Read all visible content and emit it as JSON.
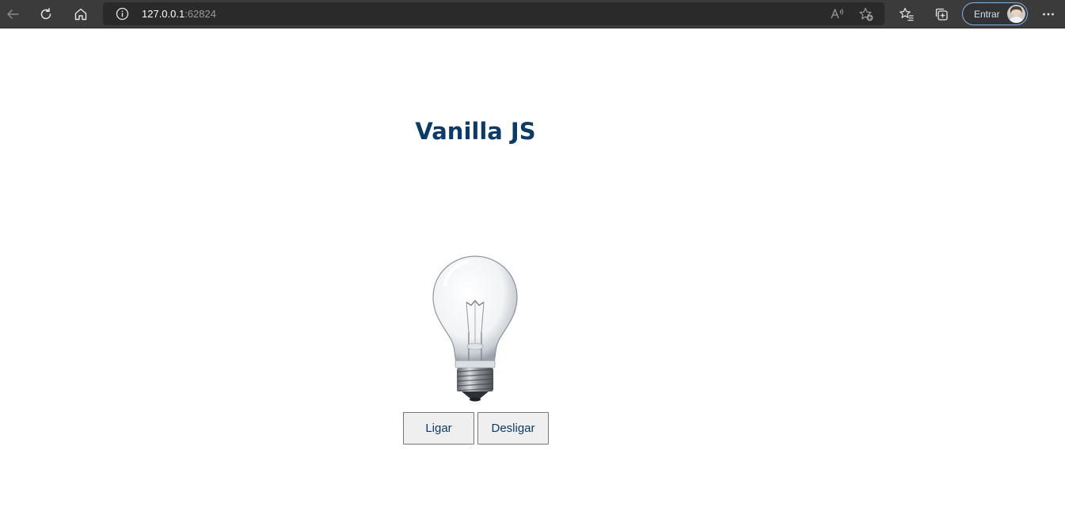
{
  "browser": {
    "url_host": "127.0.0.1",
    "url_port": ":62824",
    "profile_label": "Entrar",
    "icons": {
      "back": "arrow-left-icon",
      "refresh": "refresh-icon",
      "home": "home-icon",
      "site_info": "info-icon",
      "read_aloud": "read-aloud-icon",
      "add_favorite": "star-add-icon",
      "favorites": "favorites-list-icon",
      "collections": "collections-icon",
      "menu": "more-dots-icon"
    }
  },
  "page": {
    "title": "Vanilla JS",
    "image": "light-bulb",
    "buttons": {
      "on_label": "Ligar",
      "off_label": "Desligar"
    }
  },
  "colors": {
    "title": "#0d3b66",
    "toolbar": "#3b3b3b",
    "signin_border": "#7fb3e8"
  }
}
